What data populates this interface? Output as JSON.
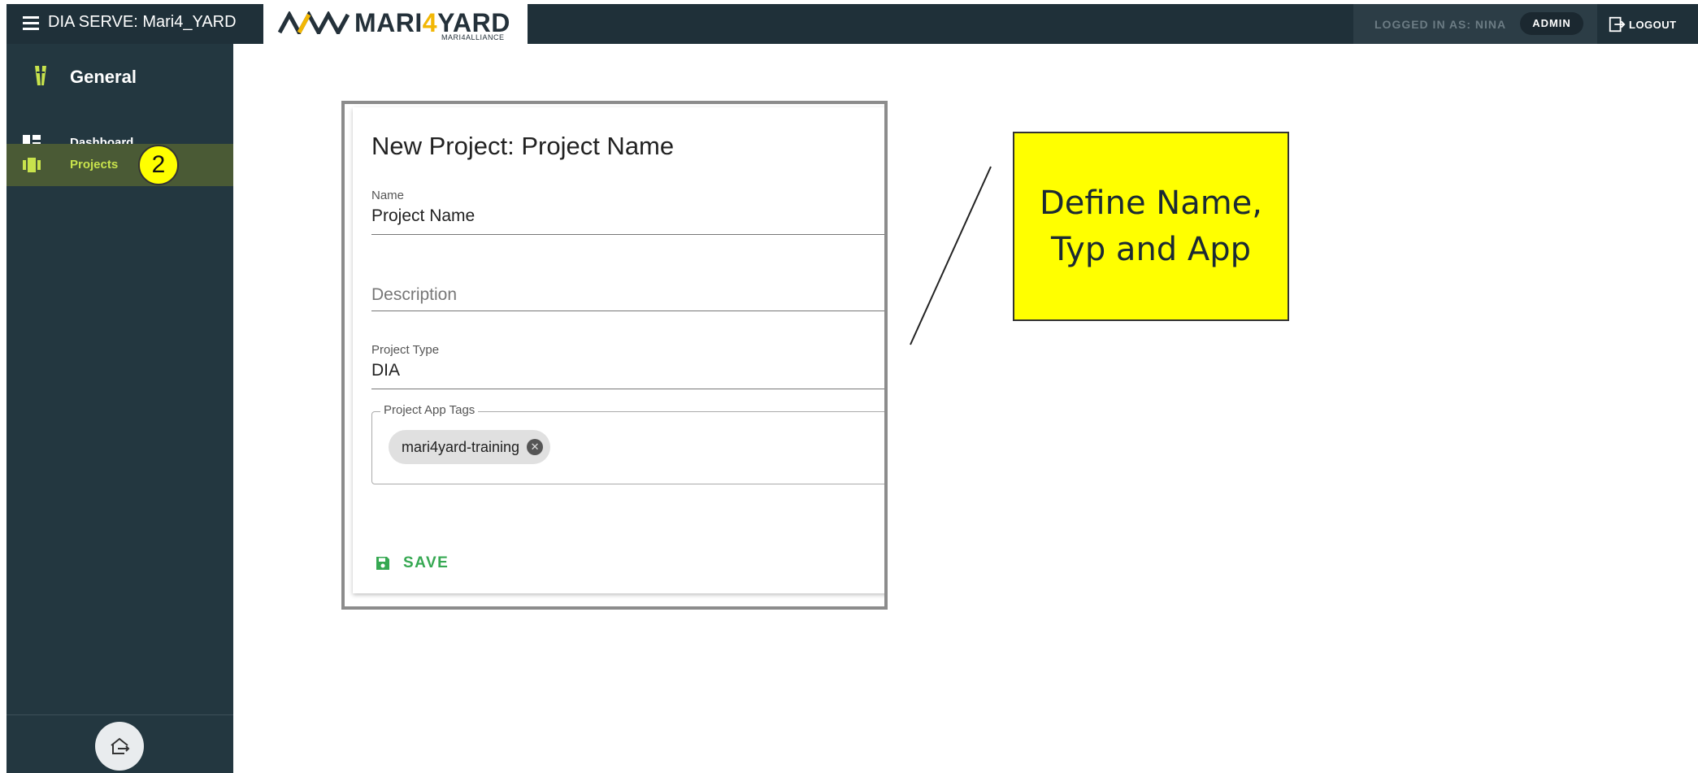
{
  "header": {
    "app_title": "DIA SERVE: Mari4_YARD",
    "logo": {
      "main_prefix": "MARI",
      "main_four": "4",
      "main_suffix": "YARD",
      "sub": "MARI4ALLIANCE"
    },
    "logged_in_label": "LOGGED IN AS: NINA",
    "role_badge": "ADMIN",
    "logout_label": "LOGOUT"
  },
  "sidebar": {
    "section_title": "General",
    "items": [
      {
        "label": "Dashboard",
        "icon": "dashboard-icon",
        "active": false
      },
      {
        "label": "Projects",
        "icon": "projects-icon",
        "active": true
      }
    ],
    "step_badge": "2",
    "colors": {
      "background": "#233740",
      "active_background": "#4a5a35",
      "active_text": "#c8e34c"
    }
  },
  "form": {
    "title": "New Project: Project Name",
    "name_label": "Name",
    "name_value": "Project Name",
    "description_placeholder": "Description",
    "type_label": "Project Type",
    "type_value": "DIA",
    "tags_label": "Project App Tags",
    "tags": [
      "mari4yard-training"
    ],
    "save_label": "SAVE",
    "colors": {
      "save": "#36a852"
    }
  },
  "callout": {
    "line1": "Define Name,",
    "line2": "Typ and App",
    "color": "#ffff00"
  }
}
